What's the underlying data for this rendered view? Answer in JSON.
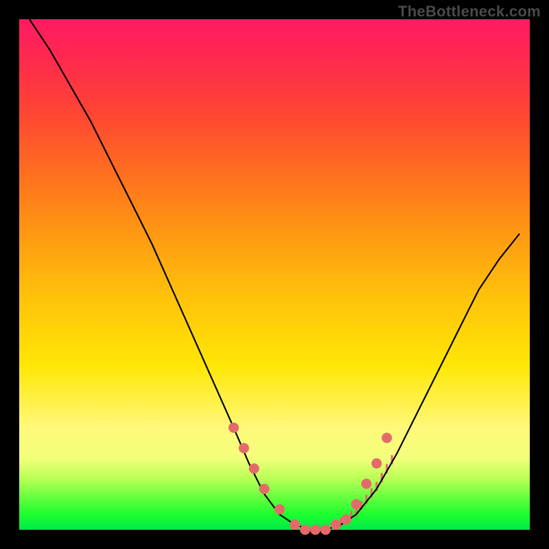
{
  "watermark": "TheBottleneck.com",
  "colors": {
    "marker": "#e46a6a",
    "curve": "#000000",
    "tick": "#e46a6a"
  },
  "chart_data": {
    "type": "line",
    "title": "",
    "xlabel": "",
    "ylabel": "",
    "xlim": [
      0,
      100
    ],
    "ylim": [
      0,
      100
    ],
    "grid": false,
    "series": [
      {
        "name": "bottleneck-curve",
        "x": [
          2,
          6,
          10,
          14,
          18,
          22,
          26,
          30,
          34,
          38,
          42,
          45,
          48,
          51,
          54,
          57,
          60,
          63,
          66,
          70,
          74,
          78,
          82,
          86,
          90,
          94,
          98
        ],
        "y": [
          100,
          94,
          87,
          80,
          72,
          64,
          56,
          47,
          38,
          29,
          20,
          13,
          7,
          3,
          1,
          0,
          0,
          1,
          3,
          8,
          15,
          23,
          31,
          39,
          47,
          53,
          58
        ]
      }
    ],
    "markers": {
      "name": "highlight-points",
      "x": [
        42,
        44,
        46,
        48,
        51,
        54,
        56,
        58,
        60,
        62,
        64,
        66,
        68,
        70,
        72
      ],
      "y": [
        20,
        16,
        12,
        8,
        4,
        1,
        0,
        0,
        0,
        1,
        2,
        5,
        9,
        13,
        18
      ]
    },
    "ticks": {
      "x": [
        63,
        64,
        65,
        66,
        67,
        68,
        69,
        70,
        71,
        72,
        73
      ]
    }
  }
}
